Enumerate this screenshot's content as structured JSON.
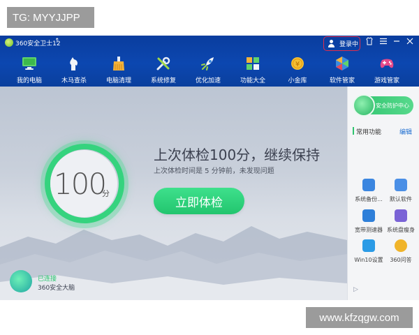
{
  "watermarks": {
    "top_left": "TG: MYYJJPP",
    "bottom_right": "www.kfzqgw.com"
  },
  "app": {
    "title": "360安全卫士12",
    "login_label": "登录中"
  },
  "colors": {
    "topbar": "#0c47b0",
    "accent_green": "#2fc46f",
    "login_border": "#e02d4c",
    "link_blue": "#1f6fd1"
  },
  "nav": [
    {
      "label": "我的电脑",
      "icon": "monitor-icon"
    },
    {
      "label": "木马查杀",
      "icon": "horse-icon"
    },
    {
      "label": "电脑清理",
      "icon": "broom-icon"
    },
    {
      "label": "系统修复",
      "icon": "wrench-icon"
    },
    {
      "label": "优化加速",
      "icon": "rocket-icon"
    },
    {
      "label": "功能大全",
      "icon": "grid-icon"
    },
    {
      "label": "小金库",
      "icon": "coin-icon"
    },
    {
      "label": "软件管家",
      "icon": "software-icon"
    },
    {
      "label": "游戏管家",
      "icon": "gamepad-icon"
    }
  ],
  "main": {
    "score": "100",
    "score_unit": "分",
    "headline": "上次体检100分，继续保持",
    "subline": "上次体检时间是 5 分钟前，未发现问题",
    "check_button": "立即体检",
    "brain_status": "已连接",
    "brain_label": "360安全大脑"
  },
  "side": {
    "guard_label": "安全防护中心",
    "section_title": "常用功能",
    "edit_label": "编辑",
    "tools": [
      {
        "label": "系统备份...",
        "icon": "backup-icon",
        "color": "#3b86e0"
      },
      {
        "label": "默认软件",
        "icon": "default-software-icon",
        "color": "#4a8fe6"
      },
      {
        "label": "宽带测速器",
        "icon": "speedtest-icon",
        "color": "#2e7fd9"
      },
      {
        "label": "系统盘瘦身",
        "icon": "disk-slim-icon",
        "color": "#7a63d6"
      },
      {
        "label": "Win10设置",
        "icon": "windows-icon",
        "color": "#2b9be6"
      },
      {
        "label": "360问答",
        "icon": "qa-icon",
        "color": "#f0b42a"
      }
    ]
  }
}
